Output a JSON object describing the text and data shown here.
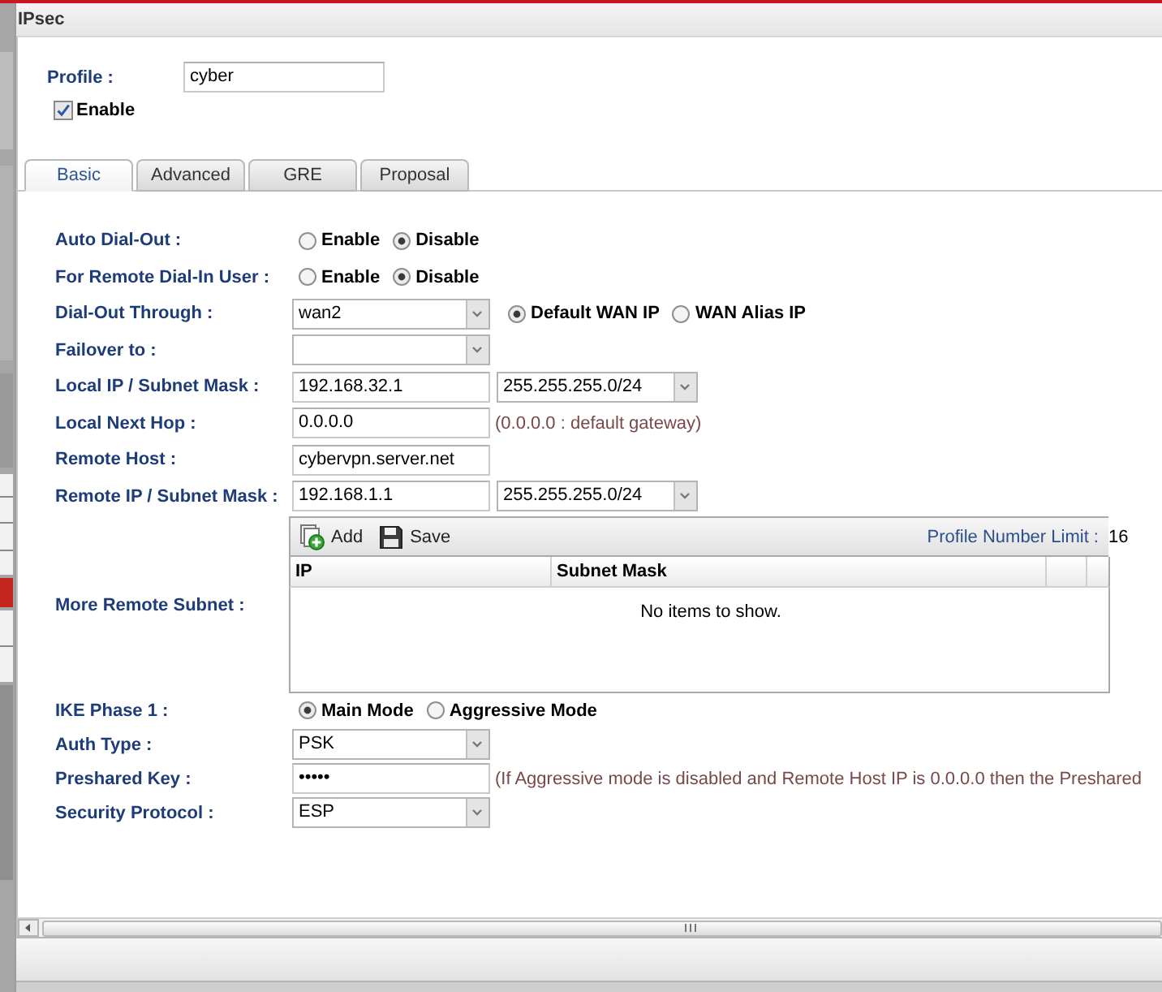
{
  "window": {
    "title": "IPsec"
  },
  "profile": {
    "label": "Profile :",
    "value": "cyber"
  },
  "enable": {
    "label": "Enable",
    "checked": true
  },
  "tabs": [
    {
      "label": "Basic",
      "selected": true
    },
    {
      "label": "Advanced",
      "selected": false
    },
    {
      "label": "GRE",
      "selected": false
    },
    {
      "label": "Proposal",
      "selected": false
    }
  ],
  "form": {
    "rows": [
      {
        "kind": "radio",
        "label": "Auto Dial-Out :",
        "options": [
          {
            "label": "Enable",
            "selected": false
          },
          {
            "label": "Disable",
            "selected": true
          }
        ]
      },
      {
        "kind": "radio",
        "label": "For Remote Dial-In User :",
        "options": [
          {
            "label": "Enable",
            "selected": false
          },
          {
            "label": "Disable",
            "selected": true
          }
        ]
      },
      {
        "kind": "select_radio",
        "label": "Dial-Out Through :",
        "value": "wan2",
        "options": [
          {
            "label": "Default WAN IP",
            "selected": true
          },
          {
            "label": "WAN Alias IP",
            "selected": false
          }
        ]
      },
      {
        "kind": "select",
        "label": "Failover to :"
      },
      {
        "kind": "ip_mask",
        "label": "Local IP / Subnet Mask :",
        "value": "192.168.32.1",
        "mask": "255.255.255.0/24"
      },
      {
        "kind": "input",
        "label": "Local Next Hop :",
        "value": "0.0.0.0",
        "note": "(0.0.0.0 : default gateway)"
      },
      {
        "kind": "input",
        "label": "Remote Host :",
        "value": "cybervpn.server.net"
      },
      {
        "kind": "ip_mask",
        "label": "Remote IP / Subnet Mask :",
        "value": "192.168.1.1",
        "mask": "255.255.255.0/24"
      },
      {
        "kind": "grid",
        "label": "More Remote Subnet :",
        "grid": {
          "buttons": [
            {
              "kind": "add",
              "label": "Add"
            },
            {
              "kind": "save",
              "label": "Save"
            }
          ],
          "limit_label": "Profile Number Limit :",
          "limit_value": "16",
          "columns": [
            "IP",
            "Subnet Mask"
          ],
          "empty_text": "No items to show."
        }
      },
      {
        "kind": "radio",
        "label": "IKE Phase 1 :",
        "options": [
          {
            "label": "Main Mode",
            "selected": true
          },
          {
            "label": "Aggressive Mode",
            "selected": false
          }
        ]
      },
      {
        "kind": "select",
        "label": "Auth Type :",
        "value": "PSK"
      },
      {
        "kind": "password",
        "label": "Preshared Key :",
        "value": "•••••",
        "note": "(If Aggressive mode is disabled and Remote Host IP is 0.0.0.0 then the Preshared"
      },
      {
        "kind": "select",
        "label": "Security Protocol :",
        "value": "ESP"
      }
    ]
  }
}
